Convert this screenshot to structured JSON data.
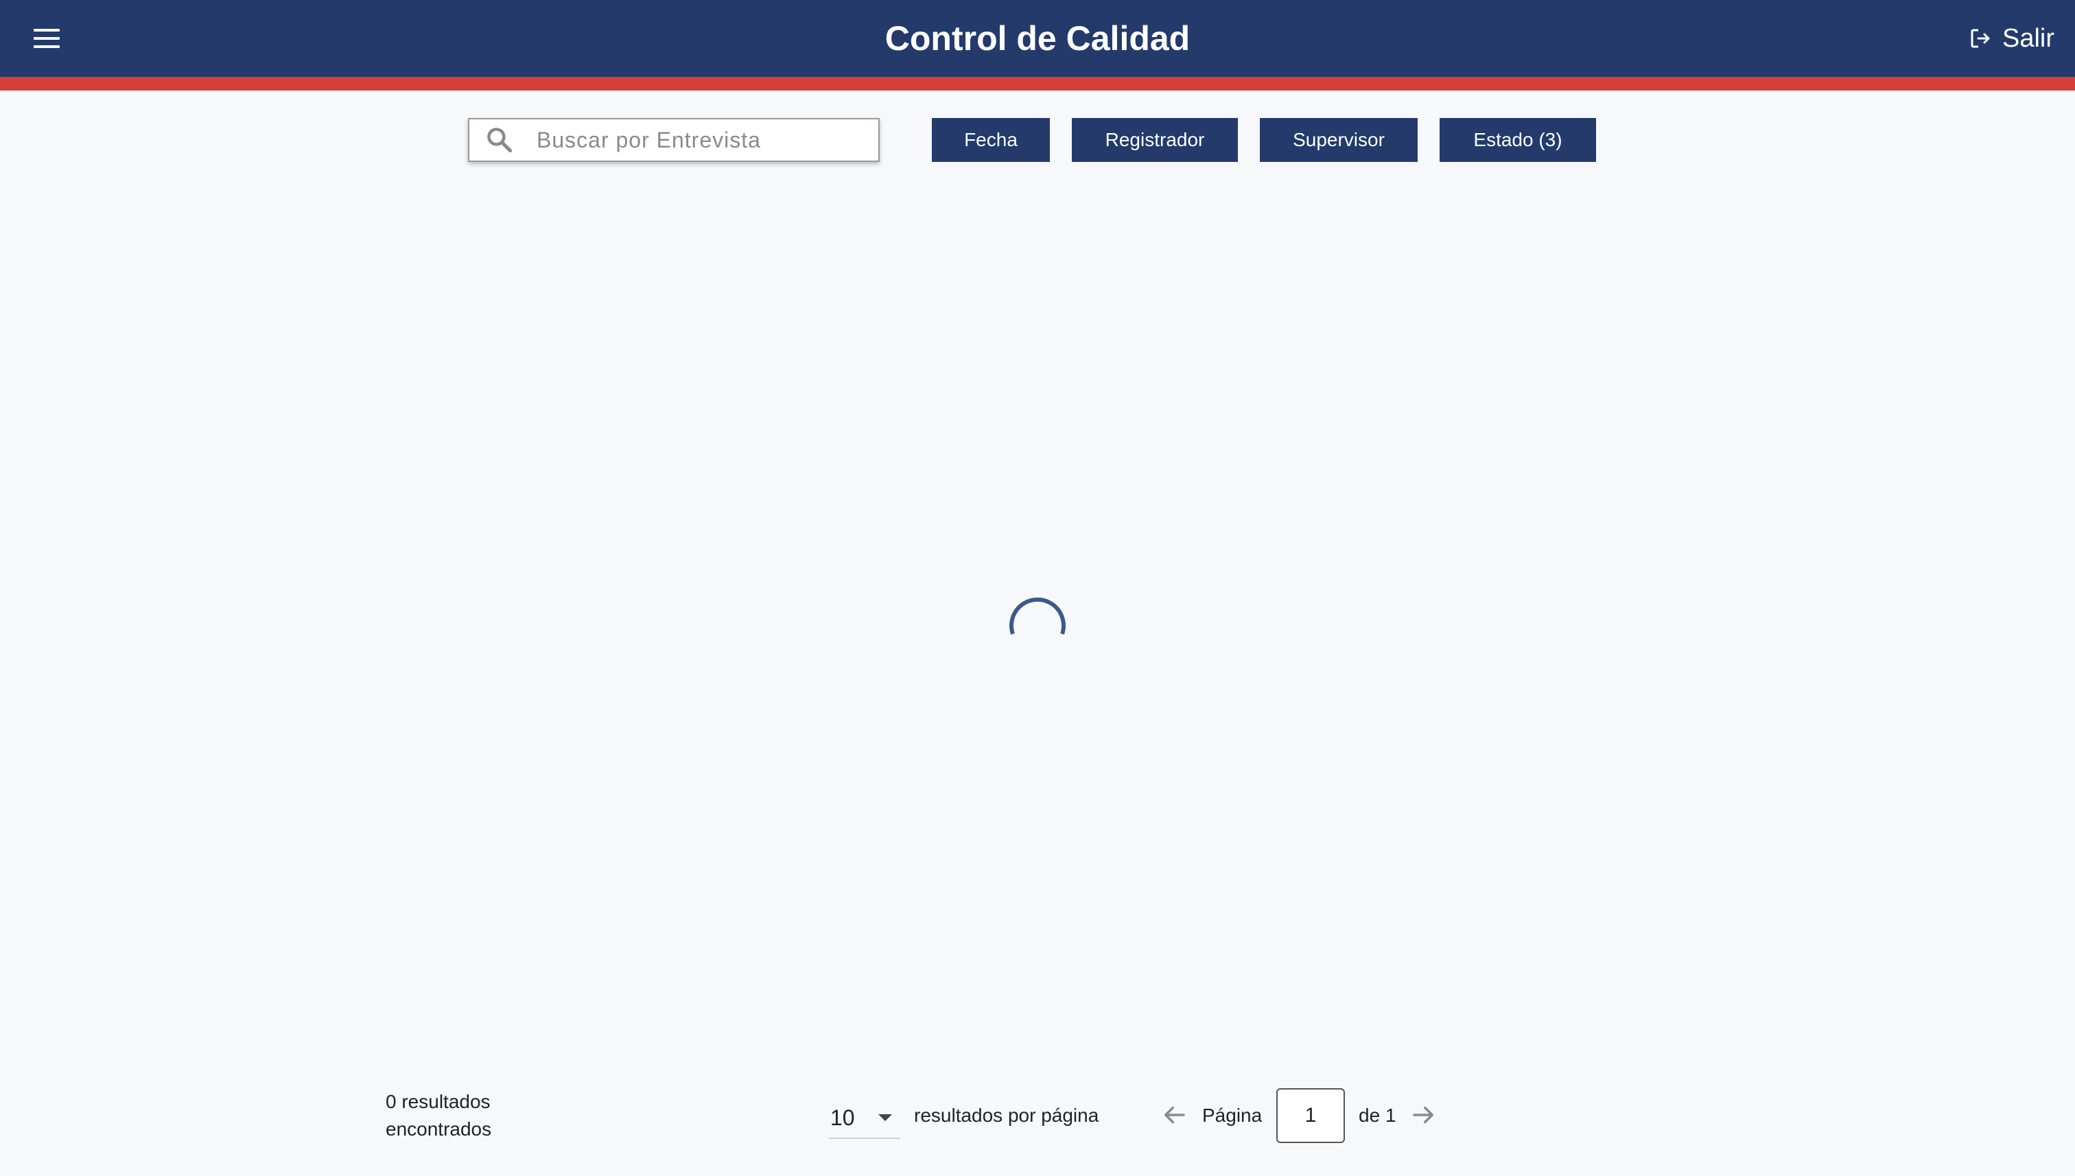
{
  "header": {
    "title": "Control de Calidad",
    "logout_label": "Salir",
    "menu_icon": "hamburger-menu-icon",
    "logout_icon": "logout-icon"
  },
  "colors": {
    "primary": "#233a6b",
    "accent_stripe": "#d43f3a",
    "background": "#f7f8fc",
    "spinner": "#3a5a8a"
  },
  "search": {
    "placeholder": "Buscar por Entrevista",
    "value": ""
  },
  "filters": {
    "fecha": "Fecha",
    "registrador": "Registrador",
    "supervisor": "Supervisor",
    "estado": "Estado (3)"
  },
  "status": {
    "loading": true
  },
  "footer": {
    "results_line1": "0 resultados",
    "results_line2": "encontrados",
    "page_size": "10",
    "per_page_label": "resultados por página",
    "page_label": "Página",
    "current_page": "1",
    "of_label": "de 1"
  }
}
